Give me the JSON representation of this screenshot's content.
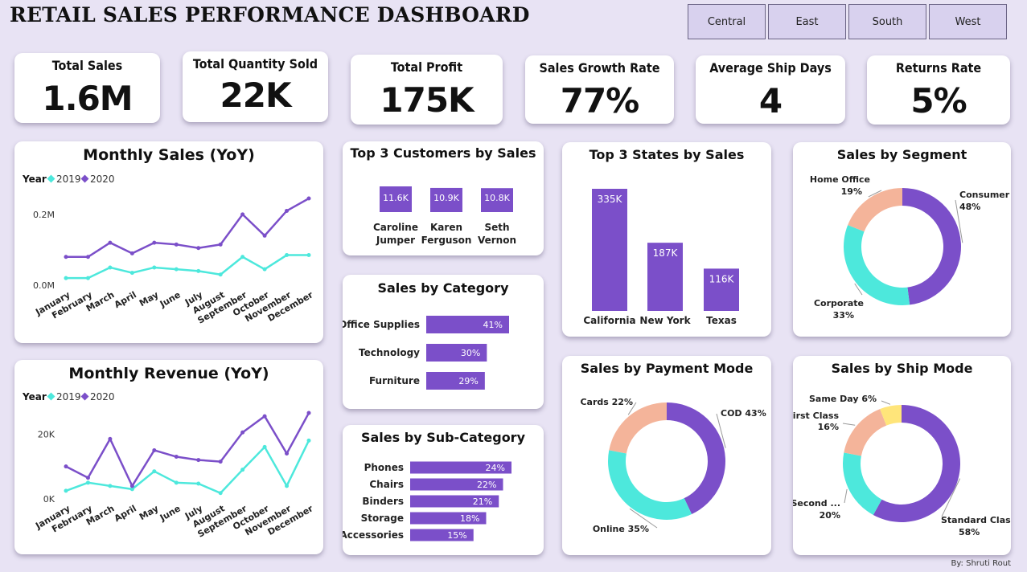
{
  "title": "RETAIL SALES PERFORMANCE DASHBOARD",
  "slicers": [
    "Central",
    "East",
    "South",
    "West"
  ],
  "kpis": [
    {
      "label": "Total Sales",
      "value": "1.6M"
    },
    {
      "label": "Total Quantity Sold",
      "value": "22K"
    },
    {
      "label": "Total Profit",
      "value": "175K"
    },
    {
      "label": "Sales Growth Rate",
      "value": "77%"
    },
    {
      "label": "Average Ship Days",
      "value": "4"
    },
    {
      "label": "Returns Rate",
      "value": "5%"
    }
  ],
  "footer": "By: Shruti Rout",
  "colors": {
    "purple": "#7b4fc9",
    "teal": "#4de8dc",
    "peach": "#f4b49a",
    "yellow": "#ffe57a"
  },
  "chart_data": [
    {
      "id": "monthly_sales",
      "type": "line",
      "title": "Monthly Sales (YoY)",
      "legend_title": "Year",
      "categories": [
        "January",
        "February",
        "March",
        "April",
        "May",
        "June",
        "July",
        "August",
        "September",
        "October",
        "November",
        "December"
      ],
      "series": [
        {
          "name": "2019",
          "values": [
            0.02,
            0.02,
            0.05,
            0.035,
            0.05,
            0.045,
            0.04,
            0.03,
            0.08,
            0.045,
            0.085,
            0.085
          ]
        },
        {
          "name": "2020",
          "values": [
            0.08,
            0.08,
            0.12,
            0.09,
            0.12,
            0.115,
            0.105,
            0.115,
            0.2,
            0.14,
            0.21,
            0.245
          ]
        }
      ],
      "yticks": [
        "0.0M",
        "0.2M"
      ],
      "ylim": [
        0,
        0.27
      ]
    },
    {
      "id": "monthly_revenue",
      "type": "line",
      "title": "Monthly Revenue (YoY)",
      "legend_title": "Year",
      "categories": [
        "January",
        "February",
        "March",
        "April",
        "May",
        "June",
        "July",
        "August",
        "September",
        "October",
        "November",
        "December"
      ],
      "series": [
        {
          "name": "2019",
          "values": [
            2500,
            5000,
            4000,
            3000,
            8500,
            5000,
            4700,
            1800,
            9000,
            16000,
            4000,
            18000
          ]
        },
        {
          "name": "2020",
          "values": [
            10000,
            6500,
            18500,
            4000,
            15000,
            13000,
            12000,
            11500,
            20500,
            25500,
            14000,
            26500
          ]
        }
      ],
      "yticks": [
        "0K",
        "20K"
      ],
      "ylim": [
        0,
        28000
      ]
    },
    {
      "id": "top_customers",
      "type": "bar",
      "title": "Top 3 Customers by Sales",
      "categories": [
        "Caroline Jumper",
        "Karen Ferguson",
        "Seth Vernon"
      ],
      "values": [
        11.6,
        10.9,
        10.8
      ],
      "data_labels": [
        "11.6K",
        "10.9K",
        "10.8K"
      ]
    },
    {
      "id": "sales_by_category",
      "type": "bar",
      "orientation": "horizontal",
      "title": "Sales by Category",
      "categories": [
        "Office Supplies",
        "Technology",
        "Furniture"
      ],
      "values": [
        41,
        30,
        29
      ],
      "data_labels": [
        "41%",
        "30%",
        "29%"
      ]
    },
    {
      "id": "sales_by_subcategory",
      "type": "bar",
      "orientation": "horizontal",
      "title": "Sales by Sub-Category",
      "categories": [
        "Phones",
        "Chairs",
        "Binders",
        "Storage",
        "Accessories"
      ],
      "values": [
        24,
        22,
        21,
        18,
        15
      ],
      "data_labels": [
        "24%",
        "22%",
        "21%",
        "18%",
        "15%"
      ]
    },
    {
      "id": "top_states",
      "type": "bar",
      "title": "Top 3 States by Sales",
      "categories": [
        "California",
        "New York",
        "Texas"
      ],
      "values": [
        335,
        187,
        116
      ],
      "data_labels": [
        "335K",
        "187K",
        "116K"
      ]
    },
    {
      "id": "sales_by_segment",
      "type": "pie",
      "title": "Sales by Segment",
      "slices": [
        {
          "name": "Consumer",
          "value": 48,
          "label": "48%"
        },
        {
          "name": "Corporate",
          "value": 33,
          "label": "33%"
        },
        {
          "name": "Home Office",
          "value": 19,
          "label": "19%"
        }
      ]
    },
    {
      "id": "sales_by_payment_mode",
      "type": "pie",
      "title": "Sales by Payment Mode",
      "slices": [
        {
          "name": "COD",
          "value": 43,
          "label": "43%"
        },
        {
          "name": "Online",
          "value": 35,
          "label": "35%"
        },
        {
          "name": "Cards",
          "value": 22,
          "label": "22%"
        }
      ]
    },
    {
      "id": "sales_by_ship_mode",
      "type": "pie",
      "title": "Sales by Ship Mode",
      "slices": [
        {
          "name": "Standard Class",
          "value": 58,
          "label": "58%"
        },
        {
          "name": "Second ...",
          "value": 20,
          "label": "20%"
        },
        {
          "name": "First Class",
          "value": 16,
          "label": "16%"
        },
        {
          "name": "Same Day",
          "value": 6,
          "label": "6%"
        }
      ]
    }
  ]
}
